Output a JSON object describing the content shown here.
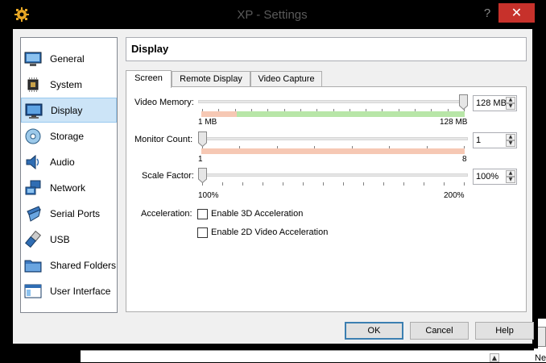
{
  "window": {
    "title": "XP - Settings",
    "help_label": "?",
    "close_label": "✕"
  },
  "sidebar": {
    "items": [
      {
        "label": "General",
        "icon": "general-icon",
        "selected": false
      },
      {
        "label": "System",
        "icon": "system-chip-icon",
        "selected": false
      },
      {
        "label": "Display",
        "icon": "display-monitor-icon",
        "selected": true
      },
      {
        "label": "Storage",
        "icon": "storage-disc-icon",
        "selected": false
      },
      {
        "label": "Audio",
        "icon": "audio-speaker-icon",
        "selected": false
      },
      {
        "label": "Network",
        "icon": "network-icon",
        "selected": false
      },
      {
        "label": "Serial Ports",
        "icon": "serial-port-icon",
        "selected": false
      },
      {
        "label": "USB",
        "icon": "usb-icon",
        "selected": false
      },
      {
        "label": "Shared Folders",
        "icon": "folder-icon",
        "selected": false
      },
      {
        "label": "User Interface",
        "icon": "user-interface-icon",
        "selected": false
      }
    ]
  },
  "header": {
    "title": "Display"
  },
  "tabs": [
    {
      "label": "Screen",
      "active": true
    },
    {
      "label": "Remote Display",
      "active": false
    },
    {
      "label": "Video Capture",
      "active": false
    }
  ],
  "screen": {
    "video_memory": {
      "label": "Video Memory:",
      "value": "128 MB",
      "min_label": "1 MB",
      "max_label": "128 MB",
      "fraction": 1.0
    },
    "monitor_count": {
      "label": "Monitor Count:",
      "value": "1",
      "min_label": "1",
      "max_label": "8",
      "fraction": 0.0
    },
    "scale_factor": {
      "label": "Scale Factor:",
      "value": "100%",
      "min_label": "100%",
      "max_label": "200%",
      "fraction": 0.0
    },
    "acceleration": {
      "label": "Acceleration:",
      "enable_3d": {
        "label": "Enable 3D Acceleration",
        "checked": false
      },
      "enable_2d": {
        "label": "Enable 2D Video Acceleration",
        "checked": false
      }
    }
  },
  "buttons": {
    "ok": "OK",
    "cancel": "Cancel",
    "help": "Help"
  },
  "background": {
    "right_text": "Ne"
  },
  "colors": {
    "close_red": "#c7312b",
    "selected_bg": "#cce4f7",
    "range_green": "#b8e6a8",
    "range_red": "#f6c8b4"
  }
}
